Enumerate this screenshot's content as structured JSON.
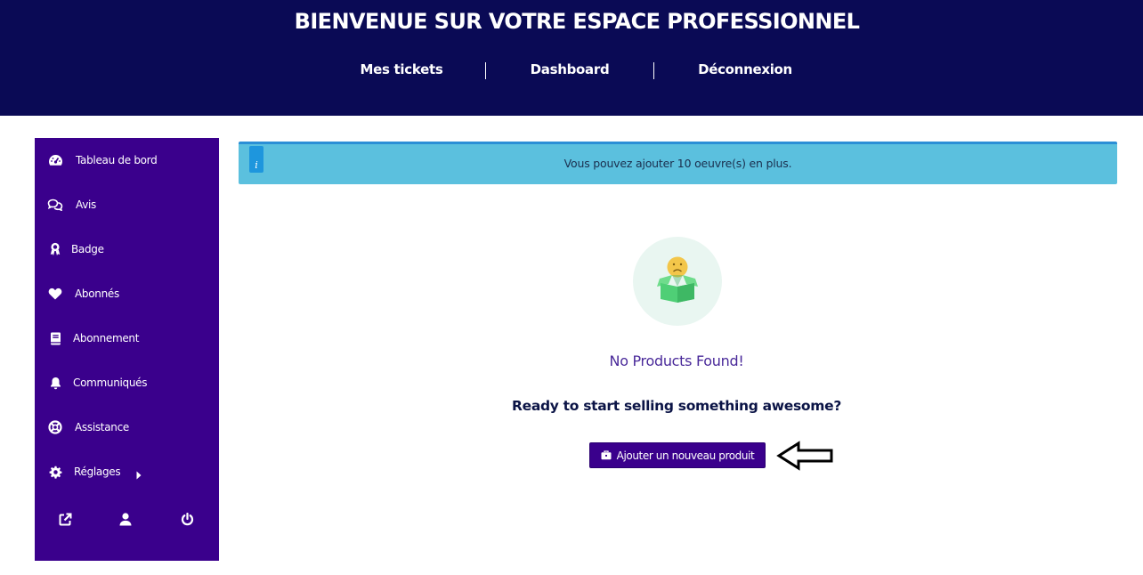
{
  "header": {
    "title": "BIENVENUE SUR VOTRE ESPACE PROFESSIONNEL",
    "nav": [
      {
        "label": "Mes tickets"
      },
      {
        "label": "Dashboard"
      },
      {
        "label": "Déconnexion"
      }
    ]
  },
  "sidebar": {
    "items": [
      {
        "label": "Tableau de bord",
        "icon": "dashboard-icon"
      },
      {
        "label": "Avis",
        "icon": "comments-icon"
      },
      {
        "label": "Badge",
        "icon": "award-icon"
      },
      {
        "label": "Abonnés",
        "icon": "heart-icon"
      },
      {
        "label": "Abonnement",
        "icon": "book-icon"
      },
      {
        "label": "Communiqués",
        "icon": "bell-icon"
      },
      {
        "label": "Assistance",
        "icon": "lifebuoy-icon"
      },
      {
        "label": "Réglages",
        "icon": "gear-icon"
      }
    ],
    "bottom_icons": [
      "external-link-icon",
      "user-icon",
      "power-icon"
    ]
  },
  "alert": {
    "badge": "i",
    "text": "Vous pouvez ajouter 10 oeuvre(s) en plus."
  },
  "empty_state": {
    "icon": "sad-box-icon",
    "title": "No Products Found!",
    "subtitle": "Ready to start selling something awesome?",
    "button_label": "Ajouter un nouveau produit",
    "button_icon": "briefcase-icon"
  },
  "colors": {
    "header_bg": "#0a0a55",
    "sidebar_bg": "#3a008c",
    "alert_bg": "#5bc0de",
    "accent": "#3a008c"
  }
}
